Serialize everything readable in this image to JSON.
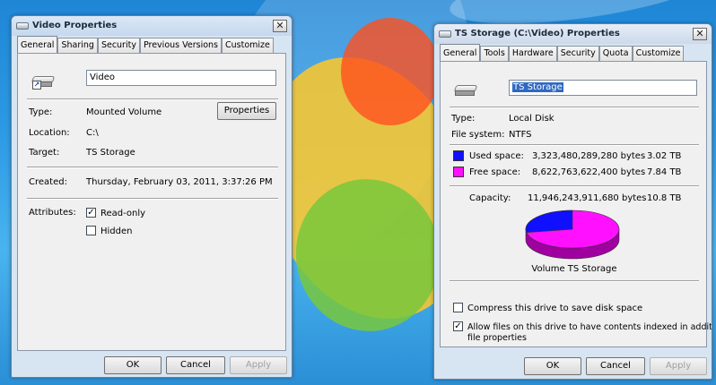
{
  "window1": {
    "title": "Video Properties",
    "tabs": [
      "General",
      "Sharing",
      "Security",
      "Previous Versions",
      "Customize"
    ],
    "name_value": "Video",
    "type_label": "Type:",
    "type_value": "Mounted Volume",
    "properties_button": "Properties",
    "location_label": "Location:",
    "location_value": "C:\\",
    "target_label": "Target:",
    "target_value": "TS Storage",
    "created_label": "Created:",
    "created_value": "Thursday, February 03, 2011, 3:37:26 PM",
    "attributes_label": "Attributes:",
    "readonly_label": "Read-only",
    "readonly_checked": true,
    "hidden_label": "Hidden",
    "hidden_checked": false,
    "ok": "OK",
    "cancel": "Cancel",
    "apply": "Apply"
  },
  "window2": {
    "title": "TS Storage (C:\\Video) Properties",
    "tabs": [
      "General",
      "Tools",
      "Hardware",
      "Security",
      "Quota",
      "Customize"
    ],
    "name_value": "TS Storage",
    "type_label": "Type:",
    "type_value": "Local Disk",
    "fs_label": "File system:",
    "fs_value": "NTFS",
    "used_label": "Used space:",
    "used_bytes": "3,323,480,289,280 bytes",
    "used_size": "3.02 TB",
    "used_color": "#1010ff",
    "free_label": "Free space:",
    "free_bytes": "8,622,763,622,400 bytes",
    "free_size": "7.84 TB",
    "free_color": "#ff10ff",
    "capacity_label": "Capacity:",
    "capacity_bytes": "11,946,243,911,680 bytes",
    "capacity_size": "10.8 TB",
    "used_fraction": 0.278,
    "volume_label": "Volume TS Storage",
    "compress_label": "Compress this drive to save disk space",
    "compress_checked": false,
    "index_label_line1": "Allow files on this drive to have contents indexed in addition to",
    "index_label_line2": "file properties",
    "index_checked": true,
    "ok": "OK",
    "cancel": "Cancel",
    "apply": "Apply"
  }
}
